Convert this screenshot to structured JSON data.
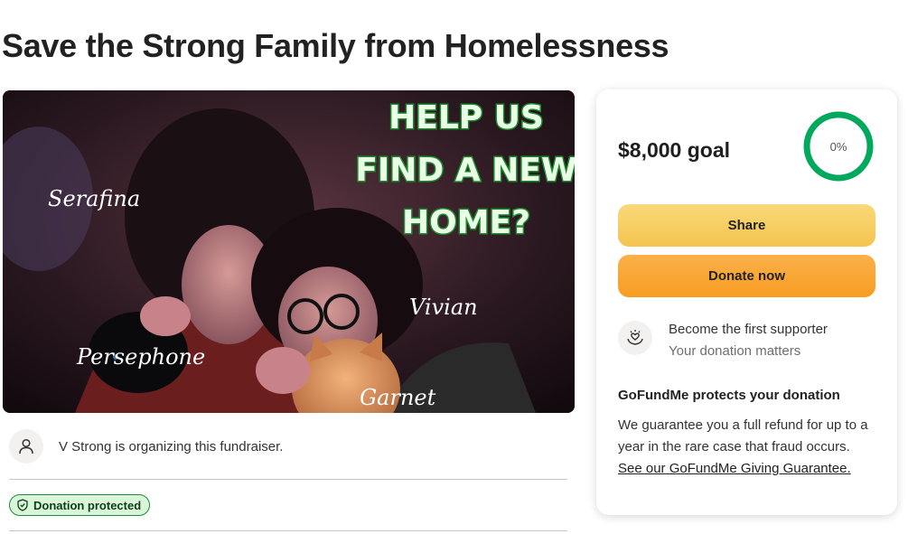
{
  "page": {
    "title": "Save the Strong Family from Homelessness"
  },
  "hero": {
    "headline_lines": [
      "HELP US",
      "FIND A NEW",
      "HOME?"
    ],
    "names": [
      "Serafina",
      "Vivian",
      "Persephone",
      "Garnet"
    ]
  },
  "organizer": {
    "text": "V Strong is organizing this fundraiser.",
    "icon": "user-icon"
  },
  "badge": {
    "label": "Donation protected",
    "icon": "shield-check-icon"
  },
  "donation_card": {
    "goal": "$8,000 goal",
    "progress_label": "0%",
    "progress": 0,
    "share_label": "Share",
    "donate_label": "Donate now",
    "supporter_title": "Become the first supporter",
    "supporter_sub": "Your donation matters",
    "supporter_icon": "heart-hands-icon",
    "protect_title": "GoFundMe protects your donation",
    "protect_body": "We guarantee you a full refund for up to a year in the rare case that fraud occurs.",
    "protect_link": "See our GoFundMe Giving Guarantee."
  },
  "colors": {
    "progress_ring": "#02a95c",
    "share_button": "#f6cd5f",
    "donate_button": "#f9a531",
    "badge_bg": "#d9f6d9",
    "badge_border": "#1b8a3a"
  }
}
